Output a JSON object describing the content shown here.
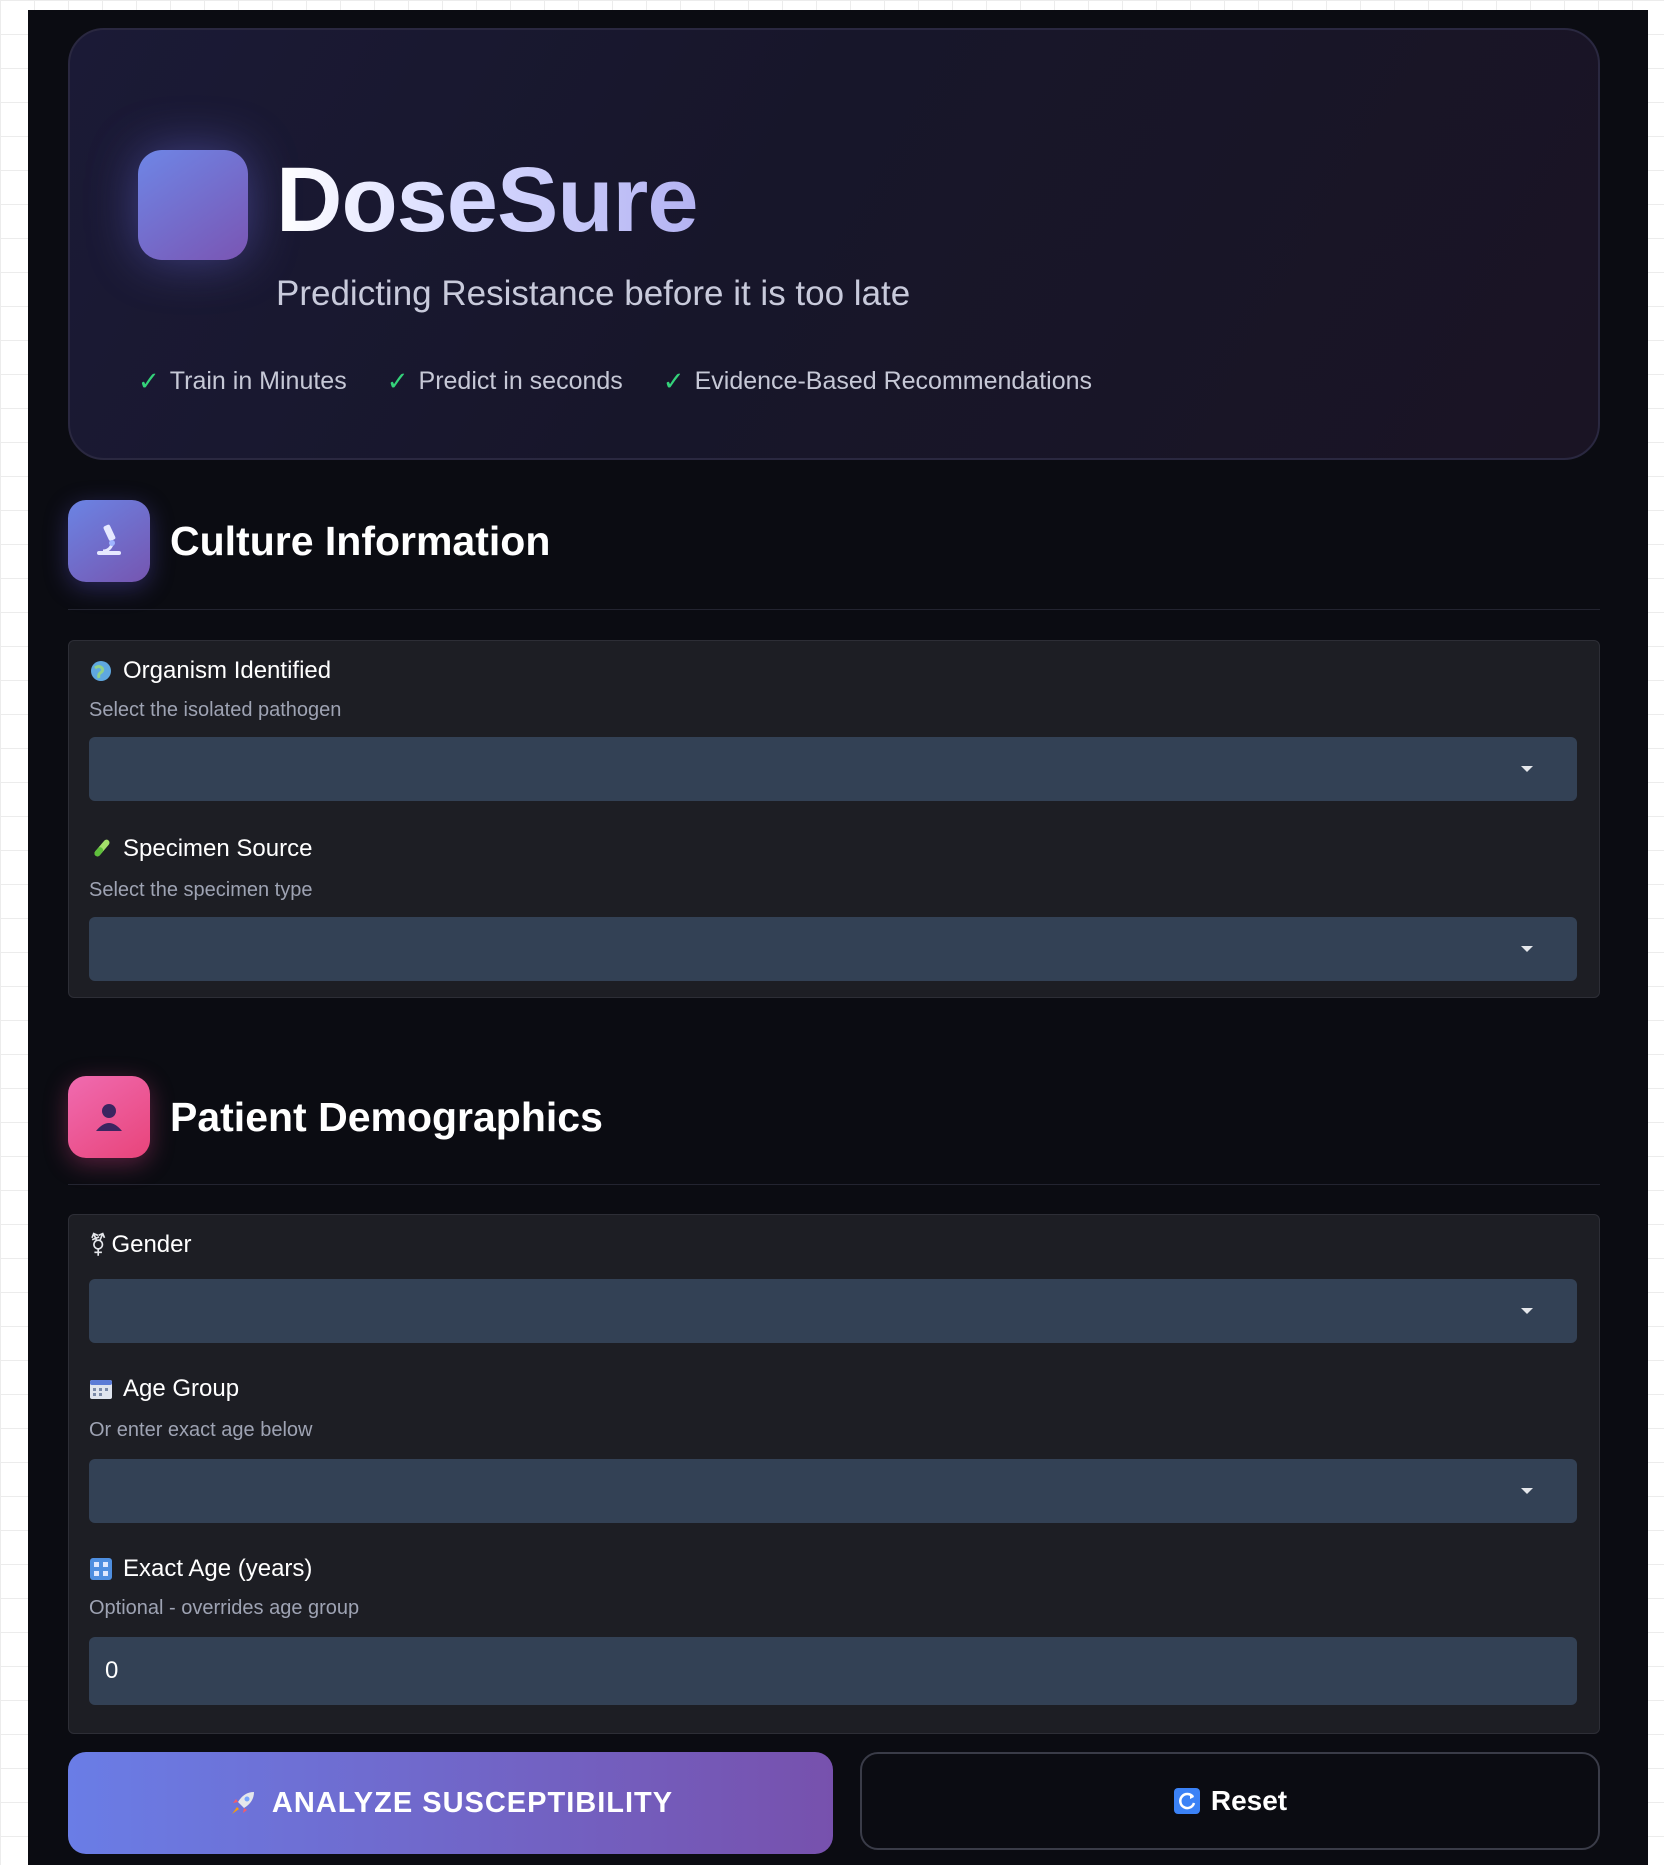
{
  "header": {
    "title": "DoseSure",
    "subtitle": "Predicting Resistance before it is too late",
    "features": [
      "Train in Minutes",
      "Predict in seconds",
      "Evidence-Based Recommendations"
    ]
  },
  "culture": {
    "title": "Culture Information",
    "organism": {
      "label": "Organism Identified",
      "hint": "Select the isolated pathogen",
      "value": ""
    },
    "specimen": {
      "label": "Specimen Source",
      "hint": "Select the specimen type",
      "value": ""
    }
  },
  "demographics": {
    "title": "Patient Demographics",
    "gender": {
      "label": "Gender",
      "value": ""
    },
    "age_group": {
      "label": "Age Group",
      "hint": "Or enter exact age below",
      "value": ""
    },
    "exact_age": {
      "label": "Exact Age (years)",
      "hint": "Optional - overrides age group",
      "value": "0"
    }
  },
  "actions": {
    "analyze_label": "ANALYZE SUSCEPTIBILITY",
    "reset_label": "Reset"
  },
  "colors": {
    "accent_start": "#6a7de6",
    "accent_end": "#7751ad",
    "check_green": "#34d27a",
    "field_bg": "#334155",
    "card_bg": "#1d1e24",
    "page_bg": "#0b0c12"
  },
  "icons": {
    "logo": "gradient-square-logo",
    "culture": "microscope-icon",
    "demographics": "person-icon",
    "organism": "globe-icon",
    "specimen": "test-tube-icon",
    "gender": "gender-symbol-icon",
    "age_group": "calendar-icon",
    "exact_age": "number-keypad-icon",
    "analyze": "rocket-icon",
    "reset": "refresh-icon"
  }
}
